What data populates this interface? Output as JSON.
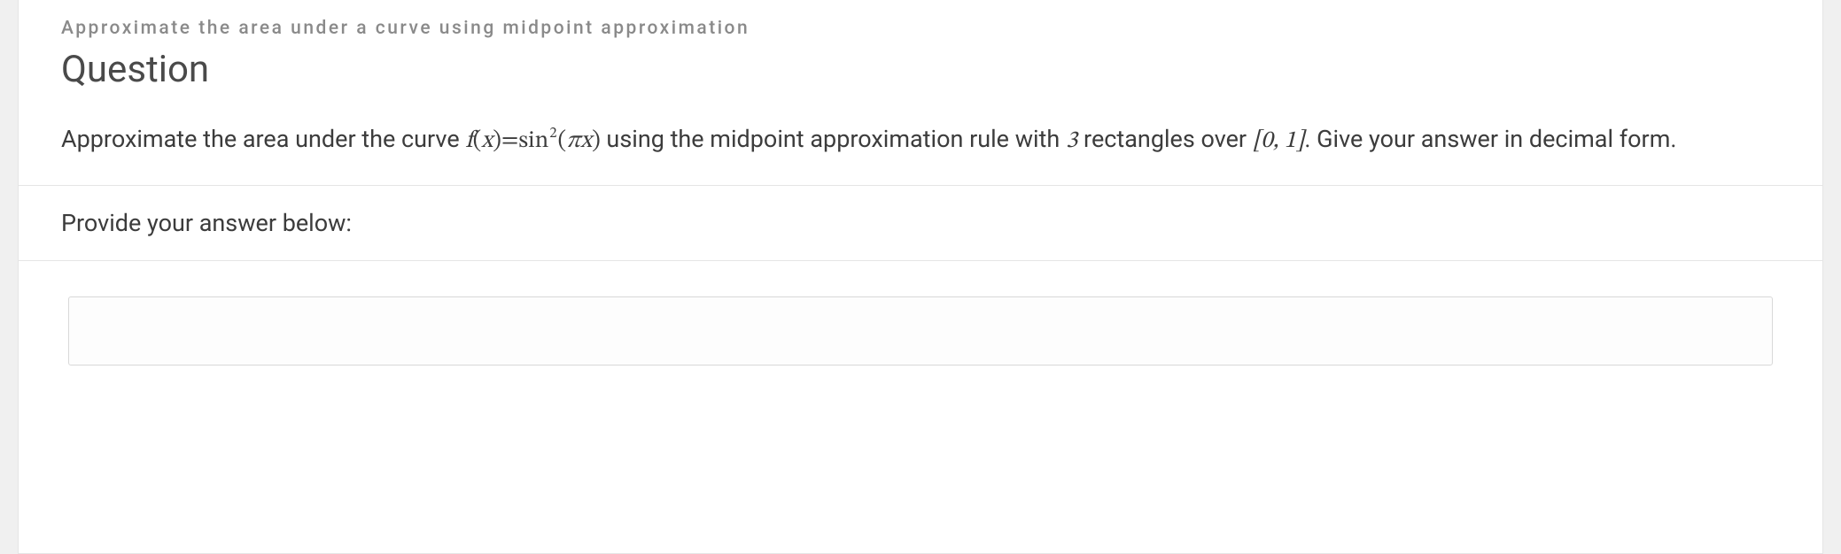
{
  "topic": "Approximate the area under a curve using midpoint approximation",
  "heading": "Question",
  "body": {
    "pre": "Approximate the area under the curve ",
    "mid": " using the midpoint approximation rule with ",
    "rects": "3",
    "tail": " rectangles over ",
    "interval": "[0, 1]",
    "close": ".  Give your answer in decimal form."
  },
  "formula": {
    "f": "f",
    "open": "(",
    "x": "x",
    "close": ")",
    "eq": " = ",
    "sin": "sin",
    "exp": "2",
    "pi": "π",
    "x2": "x"
  },
  "prompt": "Provide your answer below:",
  "input": {
    "value": "",
    "placeholder": ""
  }
}
